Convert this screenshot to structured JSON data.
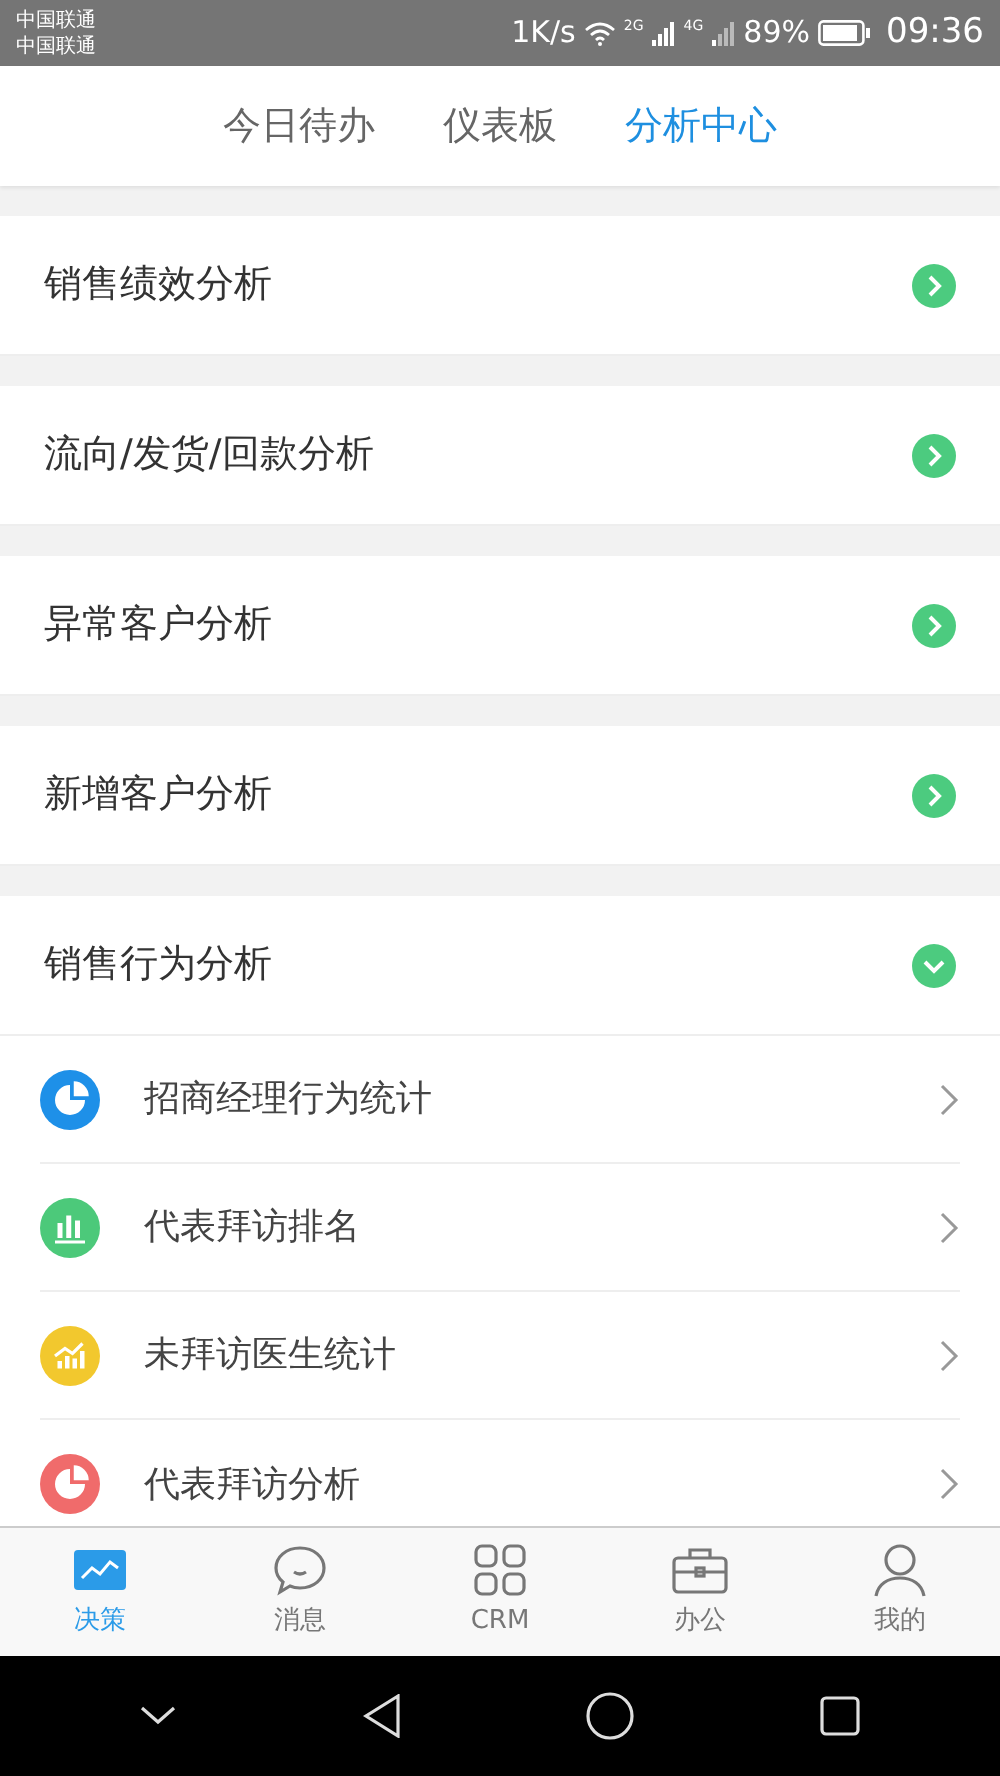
{
  "status_bar": {
    "carriers": [
      "中国联通",
      "中国联通"
    ],
    "speed": "1K/s",
    "sim1": "2G",
    "sim2": "4G",
    "battery": "89%",
    "time": "09:36"
  },
  "tabs": [
    {
      "label": "今日待办",
      "selected": false
    },
    {
      "label": "仪表板",
      "selected": false
    },
    {
      "label": "分析中心",
      "selected": true
    }
  ],
  "sections": [
    {
      "label": "销售绩效分析",
      "expanded": false
    },
    {
      "label": "流向/发货/回款分析",
      "expanded": false
    },
    {
      "label": "异常客户分析",
      "expanded": false
    },
    {
      "label": "新增客户分析",
      "expanded": false
    },
    {
      "label": "销售行为分析",
      "expanded": true,
      "children": [
        {
          "label": "招商经理行为统计",
          "kind": "pie",
          "color": "#1e90e8"
        },
        {
          "label": "代表拜访排名",
          "kind": "bar",
          "color": "#4cc97a"
        },
        {
          "label": "未拜访医生统计",
          "kind": "trend",
          "color": "#f2c82e"
        },
        {
          "label": "代表拜访分析",
          "kind": "pie",
          "color": "#f06b6b"
        }
      ]
    }
  ],
  "bottom_nav": [
    {
      "label": "决策",
      "kind": "chart",
      "selected": true
    },
    {
      "label": "消息",
      "kind": "chat",
      "selected": false
    },
    {
      "label": "CRM",
      "kind": "grid",
      "selected": false
    },
    {
      "label": "办公",
      "kind": "briefcase",
      "selected": false
    },
    {
      "label": "我的",
      "kind": "person",
      "selected": false
    }
  ]
}
